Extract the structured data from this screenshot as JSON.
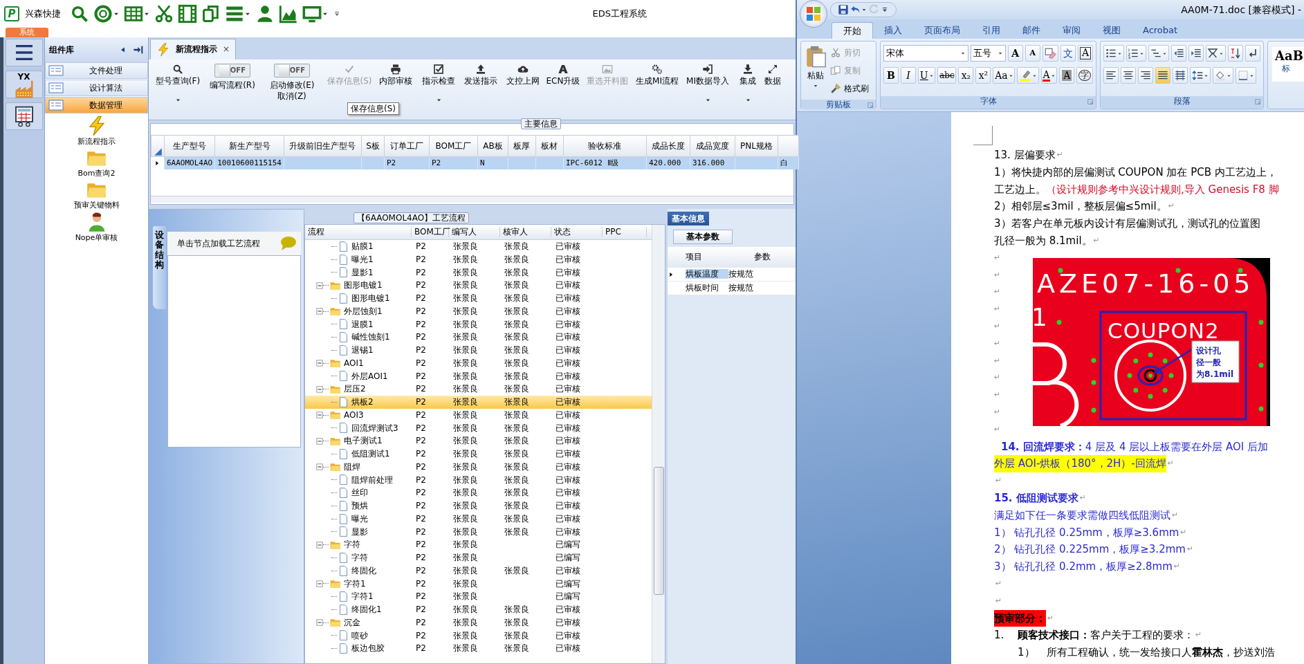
{
  "app": {
    "logo": "P",
    "brand": "兴森快捷",
    "title": "EDS工程系统",
    "system_tab": "系统",
    "quick_tools": [
      {
        "kind": "search",
        "dropdown": false
      },
      {
        "kind": "lifebuoy",
        "dropdown": true
      },
      {
        "kind": "grid",
        "dropdown": true
      },
      {
        "kind": "scissors",
        "dropdown": false
      },
      {
        "kind": "film",
        "dropdown": false
      },
      {
        "kind": "copy",
        "dropdown": false
      },
      {
        "kind": "list",
        "dropdown": true
      },
      {
        "kind": "user",
        "dropdown": false
      },
      {
        "kind": "chart",
        "dropdown": false
      },
      {
        "kind": "monitor",
        "dropdown": true
      },
      {
        "kind": "customize",
        "dropdown": false
      }
    ],
    "nav": [
      {
        "kind": "menu"
      },
      {
        "kind": "badge",
        "label": "YX"
      },
      {
        "kind": "calculator"
      }
    ],
    "component_panel": {
      "title": "组件库",
      "categories": [
        {
          "label": "文件处理",
          "selected": false
        },
        {
          "label": "设计算法",
          "selected": false
        },
        {
          "label": "数据管理",
          "selected": true
        }
      ],
      "items": [
        {
          "kind": "lightning",
          "label": "新流程指示"
        },
        {
          "kind": "folder",
          "label": "Bom查询2"
        },
        {
          "kind": "folder",
          "label": "预审关键物料"
        },
        {
          "kind": "person",
          "label": "Nope单审核"
        }
      ]
    },
    "doc_tab": {
      "label": "新流程指示",
      "close": "×"
    },
    "toolbar": [
      {
        "kind": "search",
        "lines": [
          "型号查询(F)"
        ],
        "dropdown": true,
        "disabled": false
      },
      {
        "kind": "toggle",
        "on": false,
        "state_text": "OFF",
        "lines": [
          "编写流程(R)"
        ]
      },
      {
        "kind": "toggle",
        "on": false,
        "state_text": "OFF",
        "lines": [
          "启动修改(E)",
          "取消(Z)"
        ]
      },
      {
        "kind": "check",
        "lines": [
          "保存信息(S)"
        ],
        "dropdown": false,
        "disabled": true
      },
      {
        "kind": "printer",
        "lines": [
          "内部审核"
        ],
        "dropdown": false,
        "disabled": false
      },
      {
        "kind": "checkbox",
        "lines": [
          "指示检查"
        ],
        "dropdown": true,
        "disabled": false
      },
      {
        "kind": "upload",
        "lines": [
          "发送指示"
        ],
        "dropdown": false,
        "disabled": false
      },
      {
        "kind": "cloud",
        "lines": [
          "文控上网"
        ],
        "dropdown": false,
        "disabled": false
      },
      {
        "kind": "letter",
        "lines": [
          "ECN升级"
        ],
        "dropdown": false,
        "disabled": false
      },
      {
        "kind": "image",
        "lines": [
          "重选开料图"
        ],
        "dropdown": false,
        "disabled": true
      },
      {
        "kind": "gears",
        "lines": [
          "生成MI流程"
        ],
        "dropdown": false,
        "disabled": false
      },
      {
        "kind": "import",
        "lines": [
          "MI数据导入"
        ],
        "dropdown": true,
        "disabled": false
      },
      {
        "kind": "download",
        "lines": [
          "集成"
        ],
        "dropdown": true,
        "disabled": false
      },
      {
        "kind": "expand",
        "lines": [
          "数据"
        ],
        "dropdown": false,
        "disabled": false
      }
    ],
    "tooltip": "保存信息(S)",
    "main_info": {
      "title": "主要信息",
      "columns": [
        "生产型号",
        "新生产型号",
        "升级前旧生产型号",
        "S板",
        "订单工厂",
        "BOM工厂",
        "AB板",
        "板厚",
        "板材",
        "验收标准",
        "成品长度",
        "成品宽度",
        "PNL规格"
      ],
      "rows": [
        {
          "selected": true,
          "cells": [
            "6AAOMOL4AO",
            "10010600115154",
            null,
            null,
            "P2",
            "P2",
            "N",
            null,
            null,
            "IPC-6012 Ⅱ级",
            "420.000",
            "316.000",
            null,
            "白"
          ]
        }
      ]
    },
    "device_panel": {
      "tab": "设备结构",
      "hint": "单击节点加载工艺流程"
    },
    "process": {
      "title": "【6AAOMOL4AO】工艺流程",
      "columns": [
        "流程",
        "BOM工厂",
        "编写人",
        "核审人",
        "状态",
        "PPC"
      ],
      "tree": [
        {
          "children": [
            {
              "name": "贴膜1",
              "bom": "P2",
              "writer": "张景良",
              "reviewer": "张景良",
              "status": "已审核",
              "selected": false
            },
            {
              "name": "曝光1",
              "bom": "P2",
              "writer": "张景良",
              "reviewer": "张景良",
              "status": "已审核",
              "selected": false
            },
            {
              "name": "显影1",
              "bom": "P2",
              "writer": "张景良",
              "reviewer": "张景良",
              "status": "已审核",
              "selected": false
            }
          ]
        },
        {
          "name": "图形电镀1",
          "bom": "P2",
          "writer": "张景良",
          "reviewer": "张景良",
          "status": "已审核",
          "selected": false,
          "expanded": true,
          "children": [
            {
              "name": "图形电镀1",
              "bom": "P2",
              "writer": "张景良",
              "reviewer": "张景良",
              "status": "已审核",
              "selected": false
            }
          ]
        },
        {
          "name": "外层蚀刻1",
          "bom": "P2",
          "writer": "张景良",
          "reviewer": "张景良",
          "status": "已审核",
          "selected": false,
          "expanded": true,
          "children": [
            {
              "name": "退膜1",
              "bom": "P2",
              "writer": "张景良",
              "reviewer": "张景良",
              "status": "已审核",
              "selected": false
            },
            {
              "name": "碱性蚀刻1",
              "bom": "P2",
              "writer": "张景良",
              "reviewer": "张景良",
              "status": "已审核",
              "selected": false
            },
            {
              "name": "退锡1",
              "bom": "P2",
              "writer": "张景良",
              "reviewer": "张景良",
              "status": "已审核",
              "selected": false
            }
          ]
        },
        {
          "name": "AOI1",
          "bom": "P2",
          "writer": "张景良",
          "reviewer": "张景良",
          "status": "已审核",
          "selected": false,
          "expanded": true,
          "children": [
            {
              "name": "外层AOI1",
              "bom": "P2",
              "writer": "张景良",
              "reviewer": "张景良",
              "status": "已审核",
              "selected": false
            }
          ]
        },
        {
          "name": "层压2",
          "bom": "P2",
          "writer": "张景良",
          "reviewer": "张景良",
          "status": "已审核",
          "selected": false,
          "expanded": true,
          "children": [
            {
              "name": "烘板2",
              "bom": "P2",
              "writer": "张景良",
              "reviewer": "张景良",
              "status": "已审核",
              "selected": true
            }
          ]
        },
        {
          "name": "AOI3",
          "bom": "P2",
          "writer": "张景良",
          "reviewer": "张景良",
          "status": "已审核",
          "selected": false,
          "expanded": true,
          "children": [
            {
              "name": "回流焊测试3",
              "bom": "P2",
              "writer": "张景良",
              "reviewer": "张景良",
              "status": "已审核",
              "selected": false
            }
          ]
        },
        {
          "name": "电子测试1",
          "bom": "P2",
          "writer": "张景良",
          "reviewer": "张景良",
          "status": "已审核",
          "selected": false,
          "expanded": true,
          "children": [
            {
              "name": "低阻测试1",
              "bom": "P2",
              "writer": "张景良",
              "reviewer": "张景良",
              "status": "已审核",
              "selected": false
            }
          ]
        },
        {
          "name": "阻焊",
          "bom": "P2",
          "writer": "张景良",
          "reviewer": "张景良",
          "status": "已审核",
          "selected": false,
          "expanded": true,
          "children": [
            {
              "name": "阻焊前处理",
              "bom": "P2",
              "writer": "张景良",
              "reviewer": "张景良",
              "status": "已审核",
              "selected": false
            },
            {
              "name": "丝印",
              "bom": "P2",
              "writer": "张景良",
              "reviewer": "张景良",
              "status": "已审核",
              "selected": false
            },
            {
              "name": "预烘",
              "bom": "P2",
              "writer": "张景良",
              "reviewer": "张景良",
              "status": "已审核",
              "selected": false
            },
            {
              "name": "曝光",
              "bom": "P2",
              "writer": "张景良",
              "reviewer": "张景良",
              "status": "已审核",
              "selected": false
            },
            {
              "name": "显影",
              "bom": "P2",
              "writer": "张景良",
              "reviewer": "张景良",
              "status": "已审核",
              "selected": false
            }
          ]
        },
        {
          "name": "字符",
          "bom": "P2",
          "writer": "张景良",
          "status": "已编写",
          "selected": false,
          "expanded": true,
          "children": [
            {
              "name": "字符",
              "bom": "P2",
              "writer": "张景良",
              "status": "已编写",
              "selected": false
            },
            {
              "name": "终固化",
              "bom": "P2",
              "writer": "张景良",
              "reviewer": "张景良",
              "status": "已审核",
              "selected": false
            }
          ]
        },
        {
          "name": "字符1",
          "bom": "P2",
          "writer": "张景良",
          "status": "已编写",
          "selected": false,
          "expanded": true,
          "children": [
            {
              "name": "字符1",
              "bom": "P2",
              "writer": "张景良",
              "status": "已编写",
              "selected": false
            },
            {
              "name": "终固化1",
              "bom": "P2",
              "writer": "张景良",
              "reviewer": "张景良",
              "status": "已审核",
              "selected": false
            }
          ]
        },
        {
          "name": "沉金",
          "bom": "P2",
          "writer": "张景良",
          "reviewer": "张景良",
          "status": "已审核",
          "selected": false,
          "expanded": true,
          "children": [
            {
              "name": "喷砂",
              "bom": "P2",
              "writer": "张景良",
              "reviewer": "张景良",
              "status": "已审核",
              "selected": false
            },
            {
              "name": "板边包胶",
              "bom": "P2",
              "writer": "张景良",
              "reviewer": "张景良",
              "status": "已审核",
              "selected": false
            }
          ]
        }
      ]
    },
    "info_panel": {
      "tab": "基本信息",
      "subtab": "基本参数",
      "columns": [
        "项目",
        "参数"
      ],
      "rows": [
        {
          "selected": true,
          "item": "烘板温度",
          "value": "按规范"
        },
        {
          "selected": false,
          "item": "烘板时间",
          "value": "按规范"
        }
      ]
    }
  },
  "word": {
    "title": "AA0M-71.doc [兼容模式] -",
    "qat": [
      {
        "kind": "save",
        "disabled": false,
        "dropdown": false
      },
      {
        "kind": "undo",
        "disabled": false,
        "dropdown": true
      },
      {
        "kind": "redo",
        "disabled": true,
        "dropdown": false
      },
      {
        "kind": "customize",
        "disabled": false,
        "dropdown": false
      }
    ],
    "tabs": [
      {
        "label": "开始",
        "selected": true
      },
      {
        "label": "插入",
        "selected": false
      },
      {
        "label": "页面布局",
        "selected": false
      },
      {
        "label": "引用",
        "selected": false
      },
      {
        "label": "邮件",
        "selected": false
      },
      {
        "label": "审阅",
        "selected": false
      },
      {
        "label": "视图",
        "selected": false
      },
      {
        "label": "Acrobat",
        "selected": false
      }
    ],
    "clipboard": {
      "title": "剪贴板",
      "paste": "粘贴",
      "items": [
        {
          "kind": "cut",
          "label": "剪切",
          "disabled": true
        },
        {
          "kind": "copy2",
          "label": "复制",
          "disabled": true
        },
        {
          "kind": "brush",
          "label": "格式刷",
          "disabled": false
        }
      ]
    },
    "font": {
      "title": "字体",
      "name": "宋体",
      "size": "五号",
      "row1": [
        {
          "kind": "grow",
          "text": "A",
          "dropdown": false
        },
        {
          "kind": "shrink",
          "text": "A",
          "dropdown": false
        },
        {
          "kind": "clear",
          "dropdown": false
        },
        {
          "kind": "pinyin",
          "text": "文",
          "dropdown": false
        },
        {
          "kind": "border",
          "text": "A",
          "dropdown": false
        }
      ],
      "row2": [
        {
          "kind": "bold",
          "text": "B",
          "dropdown": false
        },
        {
          "kind": "italic",
          "text": "I",
          "dropdown": false
        },
        {
          "kind": "underline",
          "text": "U",
          "dropdown": true
        },
        {
          "kind": "strike",
          "text": "abc",
          "dropdown": false
        },
        {
          "kind": "subscript",
          "text": "x₂",
          "dropdown": false
        },
        {
          "kind": "superscript",
          "text": "x²",
          "dropdown": false
        },
        {
          "kind": "case",
          "text": "Aa",
          "dropdown": true
        },
        {
          "kind": "highlight",
          "dropdown": true
        },
        {
          "kind": "color",
          "text": "A",
          "dropdown": true
        },
        {
          "kind": "shade",
          "text": "A",
          "dropdown": false
        },
        {
          "kind": "circle",
          "text": "字",
          "dropdown": false
        }
      ]
    },
    "paragraph": {
      "title": "段落",
      "row1": [
        {
          "kind": "bullets",
          "dropdown": true
        },
        {
          "kind": "numbering",
          "dropdown": true
        },
        {
          "kind": "multilevel",
          "dropdown": true
        },
        {
          "kind": "outdent",
          "dropdown": false
        },
        {
          "kind": "indent",
          "dropdown": false
        },
        {
          "kind": "asian",
          "dropdown": true
        },
        {
          "kind": "sort",
          "dropdown": false
        },
        {
          "kind": "marks",
          "dropdown": false
        }
      ],
      "alignments": [
        {
          "kind": "align-left",
          "selected": false
        },
        {
          "kind": "align-center",
          "selected": false
        },
        {
          "kind": "align-right",
          "selected": false
        },
        {
          "kind": "justify",
          "selected": true
        },
        {
          "kind": "distributed",
          "selected": false
        }
      ],
      "row2": [
        {
          "kind": "spacing",
          "dropdown": true
        },
        {
          "kind": "shading",
          "dropdown": true
        },
        {
          "kind": "borders",
          "dropdown": true
        }
      ]
    },
    "styles": {
      "sample": "AaB",
      "label": "标"
    },
    "document": [
      {
        "kind": "text",
        "runs": [
          {
            "text": "13. 层偏要求",
            "color": "#000000"
          }
        ],
        "end": "↵"
      },
      {
        "kind": "text",
        "runs": [
          {
            "text": "1）将快捷内部的层偏测试 COUPON  加在 PCB 内工艺边上，",
            "color": "#000000"
          }
        ]
      },
      {
        "kind": "text",
        "runs": [
          {
            "text": "工艺边上。",
            "color": "#000000"
          },
          {
            "text": "（设计规则参考中兴设计规则,导入 Genesis F8 脚",
            "color": "#d0102a"
          }
        ]
      },
      {
        "kind": "text",
        "runs": [
          {
            "text": "2）相邻层≤3mil，整板层偏≤5mil。",
            "color": "#000000"
          }
        ],
        "end": "↵"
      },
      {
        "kind": "text",
        "runs": [
          {
            "text": "3）若客户在单元板内设计有层偏测试孔，测试孔的位置图",
            "color": "#000000"
          }
        ]
      },
      {
        "kind": "text",
        "runs": [
          {
            "text": "孔径一般为 8.1mil。",
            "color": "#000000"
          }
        ],
        "end": "↵"
      },
      {
        "kind": "figure",
        "marks": [
          "↵",
          "↵",
          "↵",
          "↵",
          "↵",
          "↵",
          "↵",
          "↵",
          "↵",
          "↵",
          "↵"
        ],
        "board_label": "AZE07-16-05",
        "side_label": "1",
        "coupon_label": "COUPON2",
        "callout": [
          "设计孔",
          "径一般",
          "为8.1mil"
        ]
      },
      {
        "kind": "indented",
        "runs": [
          {
            "text": "**14. 回流焊要求：**4 层及 4 层以上板需要在外层 AOI 后加",
            "color": "#2a2ad0"
          }
        ]
      },
      {
        "kind": "text",
        "runs": [
          {
            "text": "外层 AOI-烘板（180°，2H）-回流焊",
            "color": "#2a2ad0",
            "highlighted": true
          }
        ],
        "end": "↵"
      },
      {
        "kind": "text",
        "end": "↵"
      },
      {
        "kind": "text",
        "runs": [
          {
            "text": "15. 低阻测试要求",
            "color": "#2a2ad0",
            "bold": true
          }
        ],
        "end": "↵"
      },
      {
        "kind": "text",
        "runs": [
          {
            "text": "满足如下任一条要求需做四线低阻测试",
            "color": "#2a2ad0"
          }
        ],
        "end": "↵"
      },
      {
        "kind": "text",
        "runs": [
          {
            "text": "1） 钻孔孔径 0.25mm，板厚≥3.6mm",
            "color": "#2a2ad0"
          }
        ],
        "end": "↵"
      },
      {
        "kind": "text",
        "runs": [
          {
            "text": "2） 钻孔孔径 0.225mm，板厚≥3.2mm",
            "color": "#2a2ad0"
          }
        ],
        "end": "↵"
      },
      {
        "kind": "text",
        "runs": [
          {
            "text": "3） 钻孔孔径 0.2mm，板厚≥2.8mm",
            "color": "#2a2ad0"
          }
        ],
        "end": "↵"
      },
      {
        "kind": "text",
        "end": "↵"
      },
      {
        "kind": "text",
        "end": "↵"
      },
      {
        "kind": "banner",
        "runs": [
          {
            "text": "预审部分：",
            "color": "#000000",
            "bold": true
          }
        ],
        "end": "↵"
      },
      {
        "kind": "numbered",
        "number": "1.",
        "runs": [
          {
            "text": "**顾客技术接口：**客户关于工程的要求：",
            "color": "#000000"
          }
        ],
        "end": "↵"
      },
      {
        "kind": "subnumbered",
        "number": "1）",
        "runs": [
          {
            "text": "所有工程确认，统一发给接口人**霍林杰**，抄送刘浩",
            "color": "#000000"
          }
        ]
      }
    ]
  }
}
